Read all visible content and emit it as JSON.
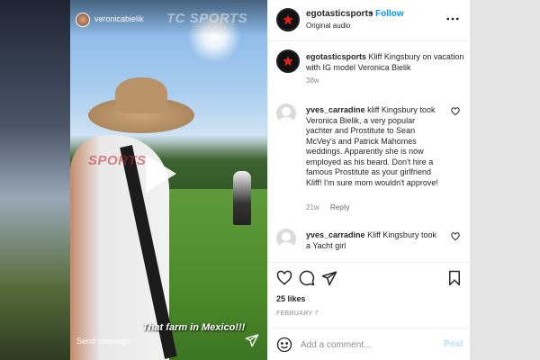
{
  "story": {
    "username": "veronicabielik",
    "watermark": "TC SPORTS",
    "watermark_mid": "SPORTS",
    "caption": "That farm in Mexico!!!",
    "send_message": "Send message"
  },
  "post": {
    "header": {
      "username": "egotasticsports",
      "separator": "•",
      "follow_label": "Follow",
      "audio": "Original audio"
    },
    "caption": {
      "username": "egotasticsports",
      "text": "Kliff Kingsbury on vacation with IG model Veronica Bielik",
      "time": "38w"
    },
    "comments": [
      {
        "username": "yves_carradine",
        "text": "kliff Kingsbury took Veronica Bielik, a very popular yachter and Prostitute to Sean McVey's and Patrick Mahomes weddings. Apparently she is now employed as his beard. Don't hire a famous Prostitute as your girlfriend Kliff! I'm sure mom wouldn't approve!",
        "time": "21w",
        "reply_label": "Reply"
      },
      {
        "username": "yves_carradine",
        "text": "Kliff Kingsbury took a Yacht girl",
        "time": "",
        "reply_label": ""
      }
    ],
    "likes": "25 likes",
    "date": "FEBRUARY 7",
    "add_comment": {
      "placeholder": "Add a comment...",
      "post_label": "Post"
    }
  },
  "icons": [
    "more-icon",
    "heart-icon",
    "comment-icon",
    "share-icon",
    "bookmark-icon",
    "emoji-icon",
    "play-icon",
    "send-icon"
  ],
  "colors": {
    "link": "#0095f6",
    "post_disabled": "#b2dffc",
    "text": "#262626",
    "muted": "#8e8e8e"
  }
}
